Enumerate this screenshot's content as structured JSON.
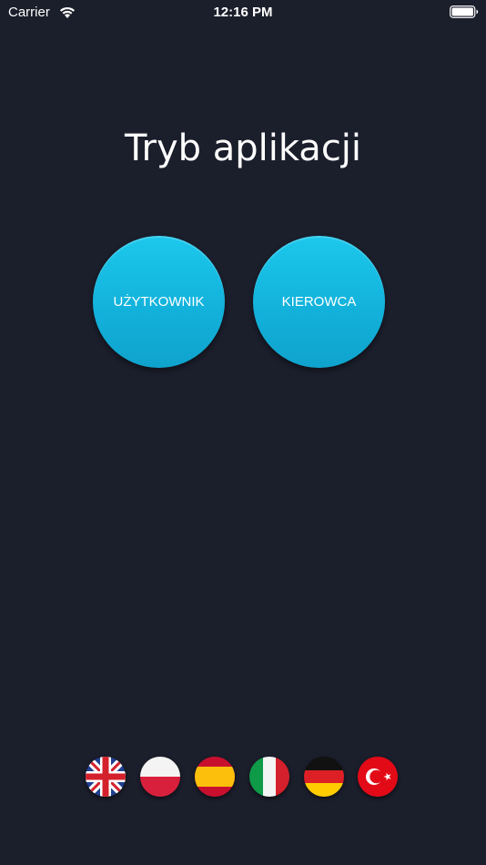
{
  "status_bar": {
    "carrier": "Carrier",
    "time": "12:16 PM"
  },
  "screen": {
    "title": "Tryb aplikacji"
  },
  "modes": {
    "user_label": "UŻYTKOWNIK",
    "driver_label": "KIEROWCA"
  },
  "languages": [
    {
      "flag": "uk-flag-icon"
    },
    {
      "flag": "poland-flag-icon"
    },
    {
      "flag": "spain-flag-icon"
    },
    {
      "flag": "italy-flag-icon"
    },
    {
      "flag": "germany-flag-icon"
    },
    {
      "flag": "turkey-flag-icon"
    }
  ],
  "colors": {
    "background": "#1b1e2b",
    "button": "#17bde4"
  }
}
